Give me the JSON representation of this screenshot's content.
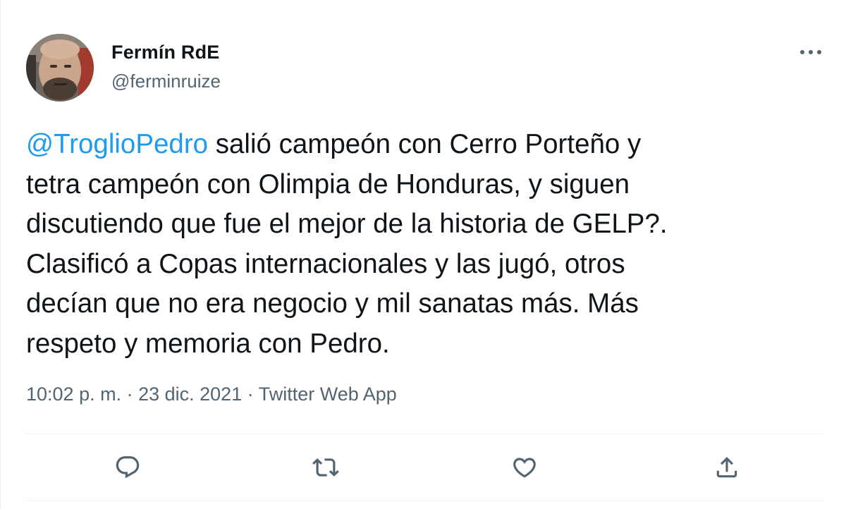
{
  "tweet": {
    "author": {
      "display_name": "Fermín RdE",
      "handle": "@ferminruize"
    },
    "text_lines": [
      {
        "mention": "@TroglioPedro",
        "text": " salió campeón con Cerro Porteño y"
      },
      {
        "text": "tetra campeón con Olimpia de Honduras, y siguen"
      },
      {
        "text": "discutiendo que fue el mejor de la historia de GELP?."
      },
      {
        "text": "Clasificó a Copas internacionales y las jugó, otros"
      },
      {
        "text": "decían que no era negocio y mil sanatas más. Más"
      },
      {
        "text": "respeto y memoria con Pedro."
      }
    ],
    "meta": {
      "time": "10:02 p. m.",
      "separator": " · ",
      "date": "23 dic. 2021",
      "source": "Twitter Web App"
    }
  },
  "actions": {
    "reply_icon": "reply-icon",
    "retweet_icon": "retweet-icon",
    "like_icon": "heart-icon",
    "share_icon": "share-icon",
    "more_icon": "more-icon"
  },
  "colors": {
    "text": "#0f1419",
    "secondary": "#536471",
    "link": "#1d9bf0",
    "divider": "#eff3f4"
  }
}
